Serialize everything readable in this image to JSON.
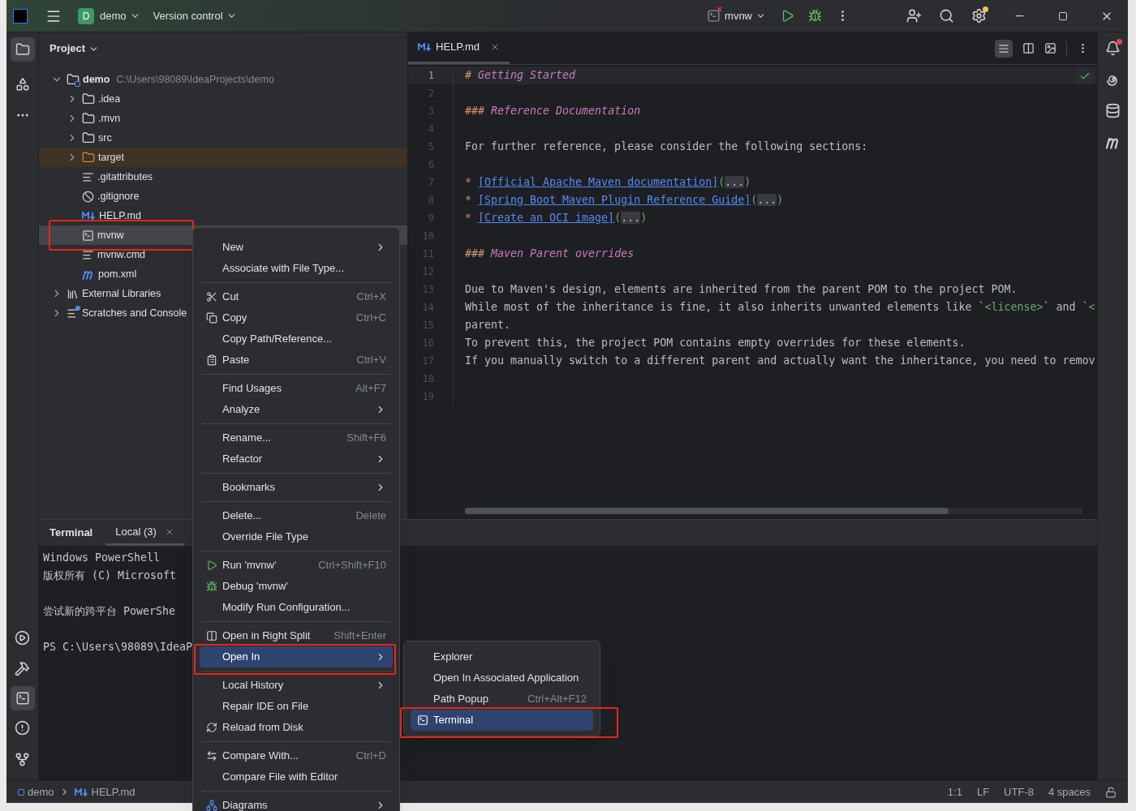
{
  "title_bar": {
    "project_badge": "D",
    "project": "demo",
    "vcs": "Version control",
    "run_config": "mvnw"
  },
  "project_panel": {
    "title": "Project",
    "tree": [
      {
        "label": "demo",
        "path": "C:\\Users\\98089\\IdeaProjects\\demo",
        "kind": "module",
        "expanded": true,
        "selected": false,
        "children": [
          {
            "label": ".idea",
            "kind": "folder",
            "expanded": false,
            "selected": false
          },
          {
            "label": ".mvn",
            "kind": "folder",
            "expanded": false,
            "selected": false
          },
          {
            "label": "src",
            "kind": "folder",
            "expanded": false,
            "selected": false
          },
          {
            "label": "target",
            "kind": "excluded-folder",
            "expanded": false,
            "selected": false
          },
          {
            "label": ".gitattributes",
            "kind": "text-file",
            "selected": false
          },
          {
            "label": ".gitignore",
            "kind": "ignore-file",
            "selected": false
          },
          {
            "label": "HELP.md",
            "kind": "markdown",
            "selected": false
          },
          {
            "label": "mvnw",
            "kind": "terminal-file",
            "selected": true,
            "highlighted": true
          },
          {
            "label": "mvnw.cmd",
            "kind": "text-file",
            "selected": false
          },
          {
            "label": "pom.xml",
            "kind": "maven",
            "selected": false
          }
        ]
      },
      {
        "label": "External Libraries",
        "kind": "library",
        "expanded": false,
        "selected": false
      },
      {
        "label": "Scratches and Console",
        "kind": "scratches",
        "expanded": false,
        "selected": false
      }
    ]
  },
  "editor": {
    "tabs": [
      {
        "label": "HELP.md",
        "selected": true
      }
    ],
    "lines": [
      {
        "number": "1",
        "current": true,
        "segments": [
          {
            "kind": "mark",
            "text": "# "
          },
          {
            "kind": "heading",
            "text": "Getting Started"
          }
        ]
      },
      {
        "number": "2",
        "current": false
      },
      {
        "number": "3",
        "current": false,
        "segments": [
          {
            "kind": "mark",
            "text": "### "
          },
          {
            "kind": "heading",
            "text": "Reference Documentation"
          }
        ]
      },
      {
        "number": "4",
        "current": false
      },
      {
        "number": "5",
        "current": false,
        "segments": [
          {
            "kind": "text",
            "text": "For further reference, please consider the following sections:"
          }
        ]
      },
      {
        "number": "6",
        "current": false
      },
      {
        "number": "7",
        "current": false,
        "segments": [
          {
            "kind": "mark",
            "text": "* "
          },
          {
            "kind": "link",
            "text": "[Official Apache Maven documentation]"
          },
          {
            "kind": "paren",
            "text": "("
          },
          {
            "kind": "fold",
            "text": "..."
          },
          {
            "kind": "paren",
            "text": ")"
          }
        ]
      },
      {
        "number": "8",
        "current": false,
        "segments": [
          {
            "kind": "mark",
            "text": "* "
          },
          {
            "kind": "link",
            "text": "[Spring Boot Maven Plugin Reference Guide]"
          },
          {
            "kind": "paren",
            "text": "("
          },
          {
            "kind": "fold",
            "text": "..."
          },
          {
            "kind": "paren",
            "text": ")"
          }
        ]
      },
      {
        "number": "9",
        "current": false,
        "segments": [
          {
            "kind": "mark",
            "text": "* "
          },
          {
            "kind": "link",
            "text": "[Create an OCI image]"
          },
          {
            "kind": "paren",
            "text": "("
          },
          {
            "kind": "fold",
            "text": "..."
          },
          {
            "kind": "paren",
            "text": ")"
          }
        ]
      },
      {
        "number": "10",
        "current": false
      },
      {
        "number": "11",
        "current": false,
        "segments": [
          {
            "kind": "mark",
            "text": "### "
          },
          {
            "kind": "heading",
            "text": "Maven Parent overrides"
          }
        ]
      },
      {
        "number": "12",
        "current": false
      },
      {
        "number": "13",
        "current": false,
        "segments": [
          {
            "kind": "text",
            "text": "Due to Maven's design, elements are inherited from the parent POM to the project POM."
          }
        ]
      },
      {
        "number": "14",
        "current": false,
        "segments": [
          {
            "kind": "text",
            "text": "While most of the inheritance is fine, it also inherits unwanted elements like `"
          },
          {
            "kind": "code",
            "text": "<license>"
          },
          {
            "kind": "text",
            "text": "` and `"
          },
          {
            "kind": "code",
            "text": "<"
          }
        ]
      },
      {
        "number": "15",
        "current": false,
        "segments": [
          {
            "kind": "text",
            "text": "parent."
          }
        ]
      },
      {
        "number": "16",
        "current": false,
        "segments": [
          {
            "kind": "text",
            "text": "To prevent this, the project POM contains empty overrides for these elements."
          }
        ]
      },
      {
        "number": "17",
        "current": false,
        "segments": [
          {
            "kind": "text",
            "text": "If you manually switch to a different parent and actually want the inheritance, you need to remov"
          }
        ]
      },
      {
        "number": "18",
        "current": false
      },
      {
        "number": "19",
        "current": false
      }
    ]
  },
  "terminal": {
    "title": "Terminal",
    "tabs": [
      {
        "label": "Local (3)",
        "selected": true
      }
    ],
    "paragraphs": [
      [
        "Windows PowerShell",
        "版权所有 (C) Microsoft"
      ],
      [
        "尝试新的跨平台 PowerShe"
      ],
      [
        "PS C:\\Users\\98089\\IdeaP"
      ]
    ]
  },
  "context_menu": {
    "groups": [
      [
        {
          "label": "New",
          "submenu": true,
          "selected": false
        },
        {
          "label": "Associate with File Type...",
          "submenu": false,
          "selected": false
        }
      ],
      [
        {
          "label": "Cut",
          "shortcut": "Ctrl+X",
          "submenu": false,
          "selected": false
        },
        {
          "label": "Copy",
          "shortcut": "Ctrl+C",
          "submenu": false,
          "selected": false
        },
        {
          "label": "Copy Path/Reference...",
          "submenu": false,
          "selected": false
        },
        {
          "label": "Paste",
          "shortcut": "Ctrl+V",
          "submenu": false,
          "selected": false
        }
      ],
      [
        {
          "label": "Find Usages",
          "shortcut": "Alt+F7",
          "submenu": false,
          "selected": false
        },
        {
          "label": "Analyze",
          "submenu": true,
          "selected": false
        }
      ],
      [
        {
          "label": "Rename...",
          "shortcut": "Shift+F6",
          "submenu": false,
          "selected": false
        },
        {
          "label": "Refactor",
          "submenu": true,
          "selected": false
        }
      ],
      [
        {
          "label": "Bookmarks",
          "submenu": true,
          "selected": false
        }
      ],
      [
        {
          "label": "Delete...",
          "shortcut": "Delete",
          "submenu": false,
          "selected": false
        },
        {
          "label": "Override File Type",
          "submenu": false,
          "selected": false
        }
      ],
      [
        {
          "label": "Run 'mvnw'",
          "shortcut": "Ctrl+Shift+F10",
          "submenu": false,
          "selected": false
        },
        {
          "label": "Debug 'mvnw'",
          "submenu": false,
          "selected": false
        },
        {
          "label": "Modify Run Configuration...",
          "submenu": false,
          "selected": false
        }
      ],
      [
        {
          "label": "Open in Right Split",
          "shortcut": "Shift+Enter",
          "submenu": false,
          "selected": false
        },
        {
          "label": "Open In",
          "submenu": true,
          "selected": true,
          "highlighted": true
        }
      ],
      [
        {
          "label": "Local History",
          "submenu": true,
          "selected": false
        },
        {
          "label": "Repair IDE on File",
          "submenu": false,
          "selected": false
        },
        {
          "label": "Reload from Disk",
          "submenu": false,
          "selected": false
        }
      ],
      [
        {
          "label": "Compare With...",
          "shortcut": "Ctrl+D",
          "submenu": false,
          "selected": false
        },
        {
          "label": "Compare File with Editor",
          "submenu": false,
          "selected": false
        }
      ],
      [
        {
          "label": "Diagrams",
          "submenu": true,
          "selected": false
        }
      ]
    ]
  },
  "submenu": {
    "items": [
      {
        "label": "Explorer",
        "selected": false
      },
      {
        "label": "Open In Associated Application",
        "selected": false
      },
      {
        "label": "Path Popup",
        "shortcut": "Ctrl+Alt+F12",
        "selected": false
      },
      {
        "label": "Terminal",
        "selected": true,
        "highlighted": true
      }
    ]
  },
  "status_bar": {
    "breadcrumbs": [
      "demo",
      "HELP.md"
    ],
    "items": [
      "1:1",
      "LF",
      "UTF-8",
      "4 spaces"
    ]
  }
}
